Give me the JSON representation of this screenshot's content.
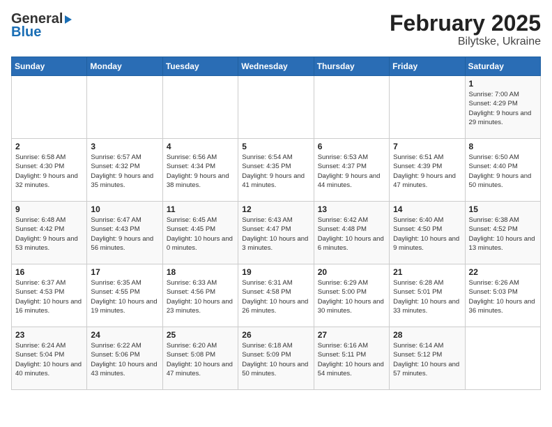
{
  "header": {
    "logo_general": "General",
    "logo_blue": "Blue",
    "title": "February 2025",
    "subtitle": "Bilytske, Ukraine"
  },
  "weekdays": [
    "Sunday",
    "Monday",
    "Tuesday",
    "Wednesday",
    "Thursday",
    "Friday",
    "Saturday"
  ],
  "weeks": [
    [
      {
        "day": "",
        "info": ""
      },
      {
        "day": "",
        "info": ""
      },
      {
        "day": "",
        "info": ""
      },
      {
        "day": "",
        "info": ""
      },
      {
        "day": "",
        "info": ""
      },
      {
        "day": "",
        "info": ""
      },
      {
        "day": "1",
        "info": "Sunrise: 7:00 AM\nSunset: 4:29 PM\nDaylight: 9 hours and 29 minutes."
      }
    ],
    [
      {
        "day": "2",
        "info": "Sunrise: 6:58 AM\nSunset: 4:30 PM\nDaylight: 9 hours and 32 minutes."
      },
      {
        "day": "3",
        "info": "Sunrise: 6:57 AM\nSunset: 4:32 PM\nDaylight: 9 hours and 35 minutes."
      },
      {
        "day": "4",
        "info": "Sunrise: 6:56 AM\nSunset: 4:34 PM\nDaylight: 9 hours and 38 minutes."
      },
      {
        "day": "5",
        "info": "Sunrise: 6:54 AM\nSunset: 4:35 PM\nDaylight: 9 hours and 41 minutes."
      },
      {
        "day": "6",
        "info": "Sunrise: 6:53 AM\nSunset: 4:37 PM\nDaylight: 9 hours and 44 minutes."
      },
      {
        "day": "7",
        "info": "Sunrise: 6:51 AM\nSunset: 4:39 PM\nDaylight: 9 hours and 47 minutes."
      },
      {
        "day": "8",
        "info": "Sunrise: 6:50 AM\nSunset: 4:40 PM\nDaylight: 9 hours and 50 minutes."
      }
    ],
    [
      {
        "day": "9",
        "info": "Sunrise: 6:48 AM\nSunset: 4:42 PM\nDaylight: 9 hours and 53 minutes."
      },
      {
        "day": "10",
        "info": "Sunrise: 6:47 AM\nSunset: 4:43 PM\nDaylight: 9 hours and 56 minutes."
      },
      {
        "day": "11",
        "info": "Sunrise: 6:45 AM\nSunset: 4:45 PM\nDaylight: 10 hours and 0 minutes."
      },
      {
        "day": "12",
        "info": "Sunrise: 6:43 AM\nSunset: 4:47 PM\nDaylight: 10 hours and 3 minutes."
      },
      {
        "day": "13",
        "info": "Sunrise: 6:42 AM\nSunset: 4:48 PM\nDaylight: 10 hours and 6 minutes."
      },
      {
        "day": "14",
        "info": "Sunrise: 6:40 AM\nSunset: 4:50 PM\nDaylight: 10 hours and 9 minutes."
      },
      {
        "day": "15",
        "info": "Sunrise: 6:38 AM\nSunset: 4:52 PM\nDaylight: 10 hours and 13 minutes."
      }
    ],
    [
      {
        "day": "16",
        "info": "Sunrise: 6:37 AM\nSunset: 4:53 PM\nDaylight: 10 hours and 16 minutes."
      },
      {
        "day": "17",
        "info": "Sunrise: 6:35 AM\nSunset: 4:55 PM\nDaylight: 10 hours and 19 minutes."
      },
      {
        "day": "18",
        "info": "Sunrise: 6:33 AM\nSunset: 4:56 PM\nDaylight: 10 hours and 23 minutes."
      },
      {
        "day": "19",
        "info": "Sunrise: 6:31 AM\nSunset: 4:58 PM\nDaylight: 10 hours and 26 minutes."
      },
      {
        "day": "20",
        "info": "Sunrise: 6:29 AM\nSunset: 5:00 PM\nDaylight: 10 hours and 30 minutes."
      },
      {
        "day": "21",
        "info": "Sunrise: 6:28 AM\nSunset: 5:01 PM\nDaylight: 10 hours and 33 minutes."
      },
      {
        "day": "22",
        "info": "Sunrise: 6:26 AM\nSunset: 5:03 PM\nDaylight: 10 hours and 36 minutes."
      }
    ],
    [
      {
        "day": "23",
        "info": "Sunrise: 6:24 AM\nSunset: 5:04 PM\nDaylight: 10 hours and 40 minutes."
      },
      {
        "day": "24",
        "info": "Sunrise: 6:22 AM\nSunset: 5:06 PM\nDaylight: 10 hours and 43 minutes."
      },
      {
        "day": "25",
        "info": "Sunrise: 6:20 AM\nSunset: 5:08 PM\nDaylight: 10 hours and 47 minutes."
      },
      {
        "day": "26",
        "info": "Sunrise: 6:18 AM\nSunset: 5:09 PM\nDaylight: 10 hours and 50 minutes."
      },
      {
        "day": "27",
        "info": "Sunrise: 6:16 AM\nSunset: 5:11 PM\nDaylight: 10 hours and 54 minutes."
      },
      {
        "day": "28",
        "info": "Sunrise: 6:14 AM\nSunset: 5:12 PM\nDaylight: 10 hours and 57 minutes."
      },
      {
        "day": "",
        "info": ""
      }
    ]
  ]
}
